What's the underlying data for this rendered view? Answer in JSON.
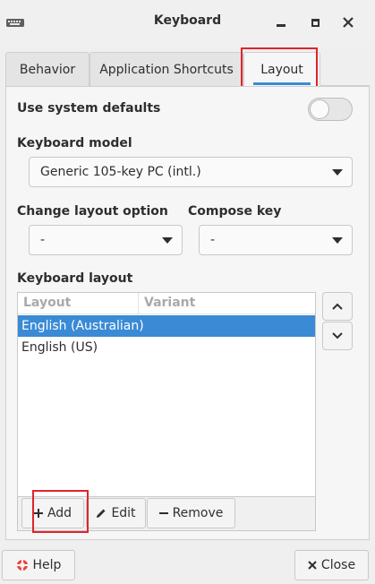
{
  "window": {
    "title": "Keyboard"
  },
  "tabs": [
    {
      "label": "Behavior"
    },
    {
      "label": "Application Shortcuts"
    },
    {
      "label": "Layout",
      "active": true
    }
  ],
  "layout": {
    "use_system_defaults": {
      "label": "Use system defaults",
      "value": false
    },
    "keyboard_model": {
      "label": "Keyboard model",
      "value": "Generic 105-key PC (intl.)"
    },
    "change_layout_option": {
      "label": "Change layout option",
      "value": "-"
    },
    "compose_key": {
      "label": "Compose key",
      "value": "-"
    },
    "keyboard_layout": {
      "label": "Keyboard layout",
      "columns": [
        "Layout",
        "Variant"
      ],
      "rows": [
        {
          "layout": "English (Australian)",
          "variant": "",
          "selected": true
        },
        {
          "layout": "English (US)",
          "variant": "",
          "selected": false
        }
      ]
    },
    "buttons": {
      "add": "Add",
      "edit": "Edit",
      "remove": "Remove"
    }
  },
  "footer": {
    "help": "Help",
    "close": "Close"
  },
  "colors": {
    "accent": "#3a8ad6",
    "highlight": "#e0242b"
  }
}
